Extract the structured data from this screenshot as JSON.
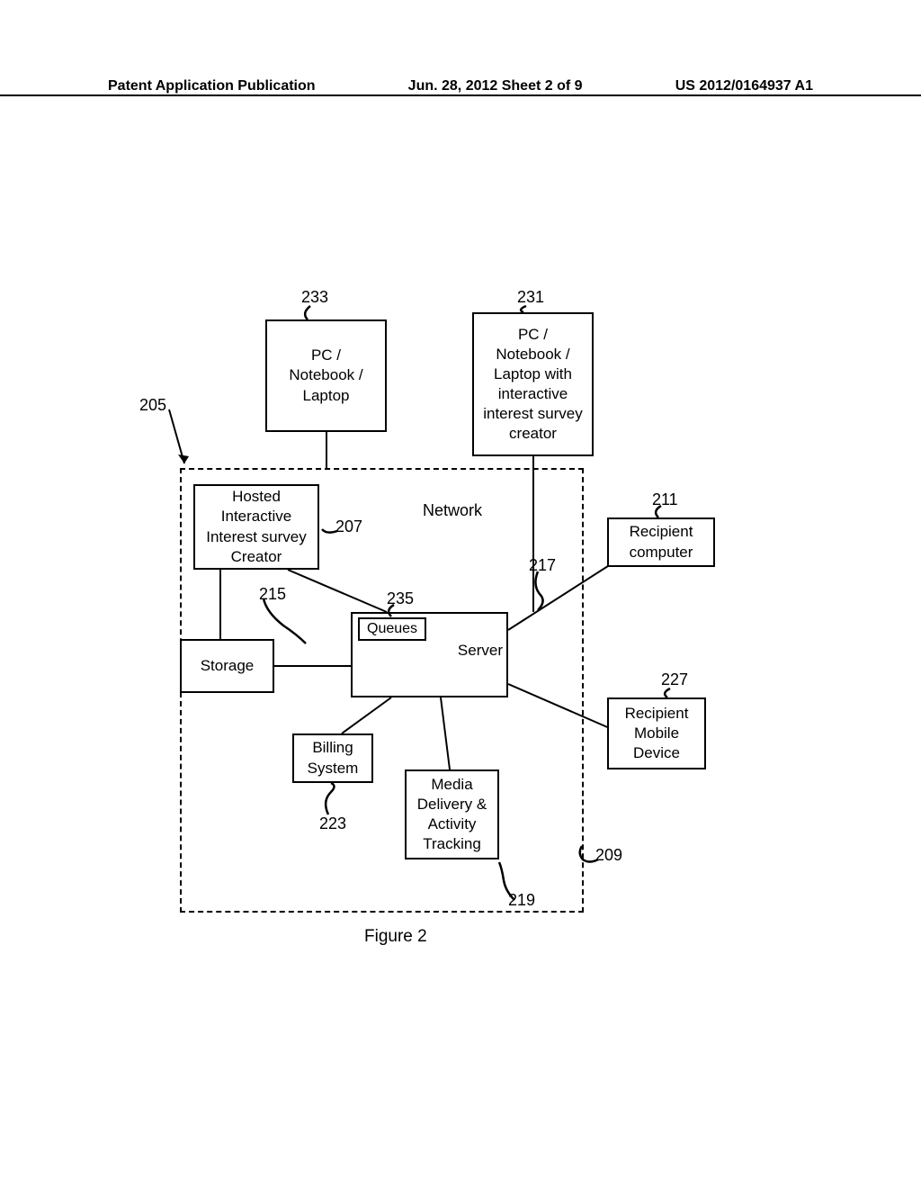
{
  "header": {
    "left": "Patent Application Publication",
    "center": "Jun. 28, 2012  Sheet 2 of 9",
    "right": "US 2012/0164937 A1"
  },
  "boxes": {
    "box233": "PC /\nNotebook /\nLaptop",
    "box231": "PC /\nNotebook /\nLaptop with\ninteractive\ninterest survey\ncreator",
    "box207": "Hosted\nInteractive\nInterest survey\nCreator",
    "box211": "Recipient\ncomputer",
    "storage": "Storage",
    "server": "Server",
    "queues": "Queues",
    "billing": "Billing\nSystem",
    "media": "Media\nDelivery &\nActivity\nTracking",
    "box227": "Recipient\nMobile\nDevice",
    "network": "Network"
  },
  "refs": {
    "r205": "205",
    "r233": "233",
    "r231": "231",
    "r207": "207",
    "r211": "211",
    "r215": "215",
    "r217": "217",
    "r235": "235",
    "r227": "227",
    "r223": "223",
    "r209": "209",
    "r219": "219"
  },
  "caption": "Figure 2"
}
